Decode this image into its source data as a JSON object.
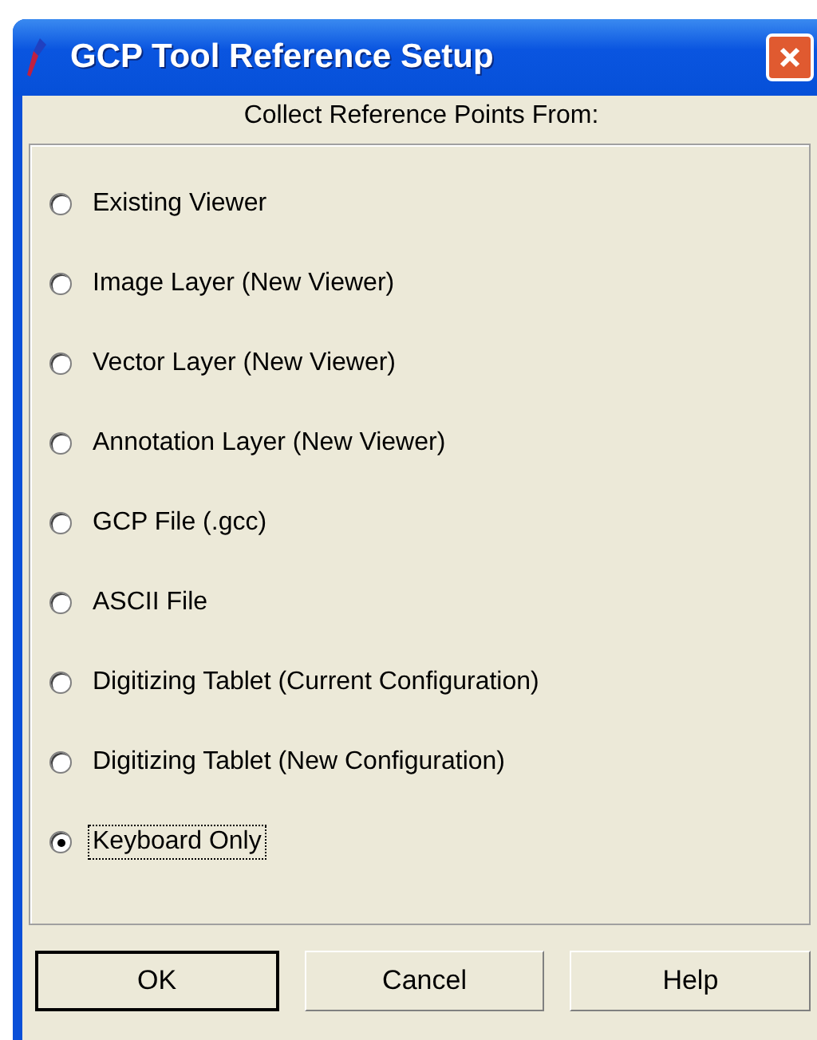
{
  "window": {
    "title": "GCP Tool Reference Setup"
  },
  "heading": "Collect Reference Points From:",
  "options": [
    {
      "label": "Existing Viewer",
      "selected": false
    },
    {
      "label": "Image Layer (New Viewer)",
      "selected": false
    },
    {
      "label": "Vector Layer (New Viewer)",
      "selected": false
    },
    {
      "label": "Annotation Layer (New Viewer)",
      "selected": false
    },
    {
      "label": "GCP File (.gcc)",
      "selected": false
    },
    {
      "label": "ASCII File",
      "selected": false
    },
    {
      "label": "Digitizing Tablet (Current Configuration)",
      "selected": false
    },
    {
      "label": "Digitizing Tablet (New Configuration)",
      "selected": false
    },
    {
      "label": "Keyboard Only",
      "selected": true
    }
  ],
  "buttons": [
    {
      "label": "OK",
      "default": true
    },
    {
      "label": "Cancel",
      "default": false
    },
    {
      "label": "Help",
      "default": false
    }
  ]
}
